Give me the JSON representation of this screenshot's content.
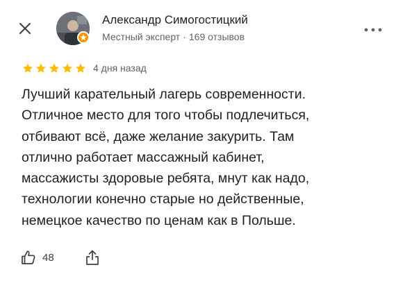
{
  "header": {
    "close_icon": "close-icon",
    "author_name": "Александр Симогостицкий",
    "author_level": "Местный эксперт",
    "meta_separator": "·",
    "review_count": "169 отзывов",
    "more_icon": "more-horizontal-icon",
    "badge_color": "#f29900"
  },
  "review": {
    "rating": 5,
    "max_rating": 5,
    "star_color": "#fbbc04",
    "date": "4 дня назад",
    "text": "Лучший карательный лагерь современности.\nОтличное место для того чтобы подлечиться,\nотбивают всё, даже желание закурить. Там\nотлично работает массажный кабинет,\nмассажисты здоровые ребята, мнут как надо,\nтехнологии конечно старые но действенные,\nнемецкое качество по ценам как в Польше."
  },
  "actions": {
    "like_icon": "thumbs-up-icon",
    "like_count": "48",
    "share_icon": "share-icon"
  }
}
